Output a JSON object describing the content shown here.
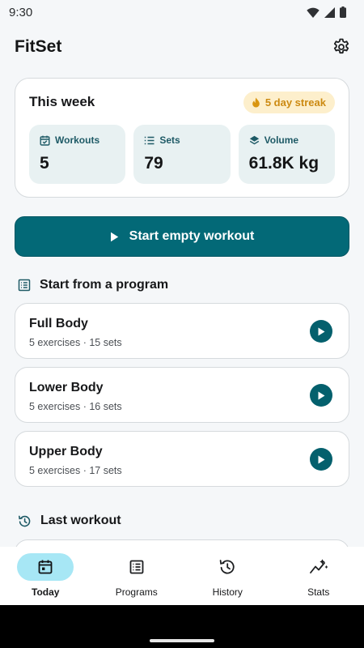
{
  "status_bar": {
    "time": "9:30",
    "icons": [
      "wifi-icon",
      "signal-icon",
      "battery-icon"
    ]
  },
  "app_bar": {
    "title": "FitSet",
    "settings_icon": "gear-icon"
  },
  "week_summary": {
    "title": "This week",
    "streak_label": "5 day streak",
    "stats": [
      {
        "label": "Workouts",
        "value": "5",
        "icon": "calendar-check-icon"
      },
      {
        "label": "Sets",
        "value": "79",
        "icon": "list-icon"
      },
      {
        "label": "Volume",
        "value": "61.8K kg",
        "icon": "layers-icon"
      }
    ]
  },
  "start_button": {
    "label": "Start empty workout"
  },
  "programs_section": {
    "title": "Start from a program",
    "programs": [
      {
        "name": "Full Body",
        "meta": "5 exercises · 15 sets"
      },
      {
        "name": "Lower Body",
        "meta": "5 exercises · 16 sets"
      },
      {
        "name": "Upper Body",
        "meta": "5 exercises · 17 sets"
      }
    ]
  },
  "last_workout_section": {
    "title": "Last workout"
  },
  "bottom_nav": {
    "active": "Today",
    "items": [
      {
        "label": "Today",
        "icon": "calendar-icon"
      },
      {
        "label": "Programs",
        "icon": "list-box-icon"
      },
      {
        "label": "History",
        "icon": "history-icon"
      },
      {
        "label": "Stats",
        "icon": "sparkline-icon"
      }
    ]
  },
  "colors": {
    "primary": "#036977",
    "streak_bg": "#fdefcc",
    "streak_text": "#cc8a12",
    "tile_bg": "#e8f1f2",
    "nav_active_bg": "#a7e7f5",
    "background": "#f5f7f9"
  }
}
